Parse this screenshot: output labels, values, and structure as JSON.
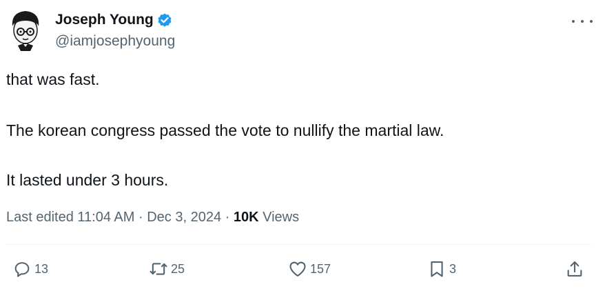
{
  "author": {
    "display_name": "Joseph Young",
    "handle": "@iamjosephyoung",
    "verified": true,
    "avatar_icon": "cartoon-avatar-icon"
  },
  "tweet": {
    "lines": [
      "that was fast.",
      "The korean congress passed the vote to nullify the martial law.",
      "It lasted under 3 hours."
    ]
  },
  "meta": {
    "edited_label": "Last edited 11:04 AM",
    "separator": "·",
    "date": "Dec 3, 2024",
    "views_count": "10K",
    "views_label": "Views"
  },
  "actions": {
    "replies": "13",
    "reposts": "25",
    "likes": "157",
    "bookmarks": "3"
  },
  "colors": {
    "text": "#0f1419",
    "secondary": "#536471",
    "verified": "#1d9bf0",
    "divider": "#eff3f4"
  }
}
